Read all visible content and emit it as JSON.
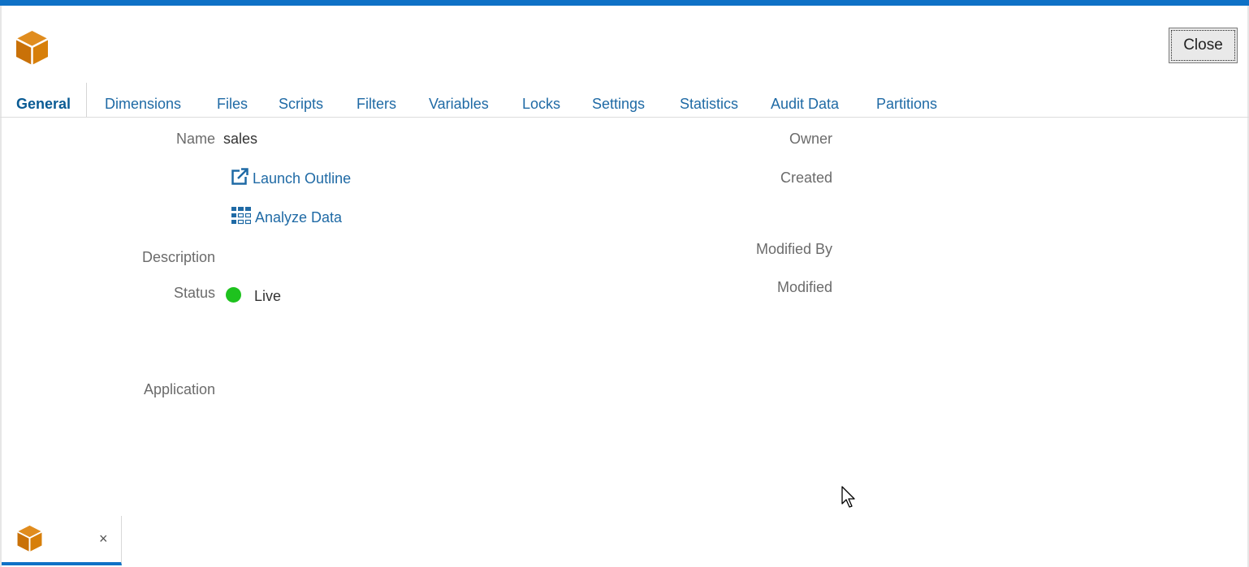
{
  "header": {
    "logo_icon": "cube-icon",
    "close_label": "Close",
    "accent_color": "#0f71c6",
    "logo_color": "#d77f0a"
  },
  "tabs": [
    {
      "label": "General",
      "active": true
    },
    {
      "label": "Dimensions",
      "active": false
    },
    {
      "label": "Files",
      "active": false
    },
    {
      "label": "Scripts",
      "active": false
    },
    {
      "label": "Filters",
      "active": false
    },
    {
      "label": "Variables",
      "active": false
    },
    {
      "label": "Locks",
      "active": false
    },
    {
      "label": "Settings",
      "active": false
    },
    {
      "label": "Statistics",
      "active": false
    },
    {
      "label": "Audit Data",
      "active": false
    },
    {
      "label": "Partitions",
      "active": false
    }
  ],
  "general": {
    "name_label": "Name",
    "name_value": "sales",
    "launch_outline_label": "Launch Outline",
    "launch_outline_icon": "external-link-icon",
    "analyze_data_label": "Analyze Data",
    "analyze_data_icon": "grid-icon",
    "description_label": "Description",
    "status_label": "Status",
    "status_value": "Live",
    "status_color": "#1ec21e",
    "application_label": "Application",
    "owner_label": "Owner",
    "created_label": "Created",
    "modified_by_label": "Modified By",
    "modified_label": "Modified"
  },
  "bottom_tab": {
    "icon": "cube-icon",
    "close_symbol": "×"
  }
}
